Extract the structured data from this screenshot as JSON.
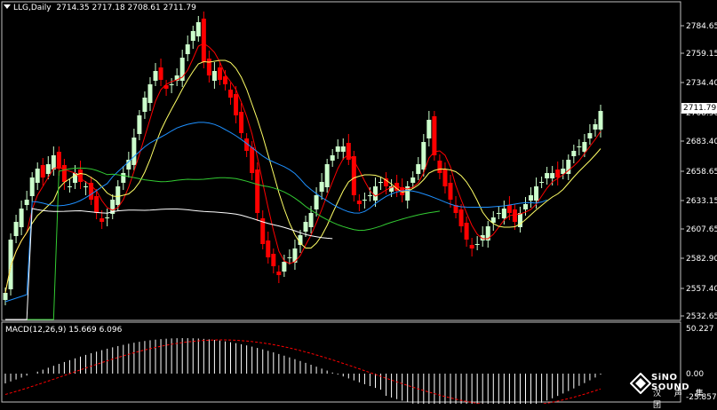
{
  "header": {
    "symbol_timeframe": "LLG,Daily",
    "ohlc": "2714.35 2717.18 2708.61 2711.79"
  },
  "price_axis": {
    "labels": [
      "2784.65",
      "2759.15",
      "2734.40",
      "2708.90",
      "2683.40",
      "2658.65",
      "2633.15",
      "2607.65",
      "2582.90",
      "2557.40",
      "2532.65"
    ],
    "current_price": "2711.79"
  },
  "macd": {
    "label": "MACD(12,26,9) 15.669 6.096",
    "axis_labels": [
      "50.227",
      "0.00",
      "-25.857"
    ]
  },
  "logo": {
    "brand": "SiNO SOUND",
    "brand_cn": "汉 声 集 团"
  },
  "colors": {
    "background": "#000000",
    "bull_candle": "#ccffcc",
    "bear_candle": "#ff0000",
    "ma_red": "#ff0000",
    "ma_yellow": "#ffff66",
    "ma_blue": "#1e90ff",
    "ma_green": "#33cc33",
    "ma_white": "#ffffff",
    "macd_hist": "#ffffff",
    "macd_signal": "#ff0000"
  }
}
